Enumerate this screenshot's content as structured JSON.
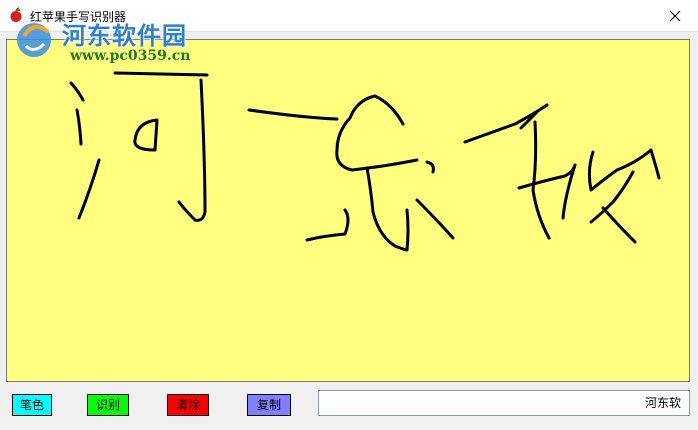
{
  "window": {
    "title": "红苹果手写识别器",
    "icon": "apple-icon",
    "close_icon": "close-icon"
  },
  "watermark": {
    "text": "河东软件园",
    "url": "www.pc0359.cn"
  },
  "canvas": {
    "background": "#ffff80",
    "ink_color": "#000000"
  },
  "buttons": {
    "pen_color": {
      "label": "笔色",
      "color": "#00ffff"
    },
    "recognize": {
      "label": "识别",
      "color": "#00ff00"
    },
    "clear": {
      "label": "清除",
      "color": "#ff0000"
    },
    "copy": {
      "label": "复制",
      "color": "#8080ff"
    }
  },
  "result": {
    "value": "河东软"
  }
}
